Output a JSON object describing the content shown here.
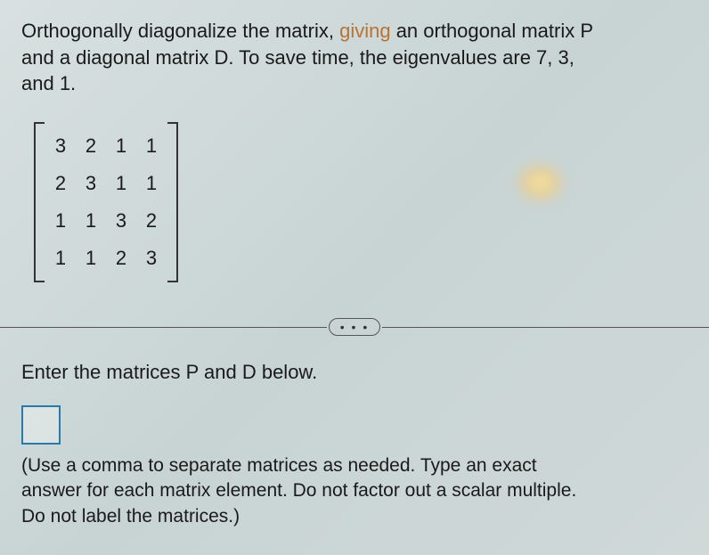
{
  "problem": {
    "line1_a": "Orthogonally diagonalize the matrix, ",
    "line1_giving": "giving",
    "line1_b": " an orthogonal matrix P",
    "line2": "and a diagonal matrix D. To save time, the eigenvalues are 7, 3,",
    "line3": "and 1."
  },
  "matrix": {
    "rows": [
      [
        "3",
        "2",
        "1",
        "1"
      ],
      [
        "2",
        "3",
        "1",
        "1"
      ],
      [
        "1",
        "1",
        "3",
        "2"
      ],
      [
        "1",
        "1",
        "2",
        "3"
      ]
    ]
  },
  "divider_dots": "• • •",
  "instruction_1": "Enter the matrices P and D below.",
  "instruction_2_line1": "(Use a comma to separate matrices as needed. Type an exact",
  "instruction_2_line2": "answer for each matrix element. Do not factor out a scalar multiple.",
  "instruction_2_line3": "Do not label the matrices.)"
}
